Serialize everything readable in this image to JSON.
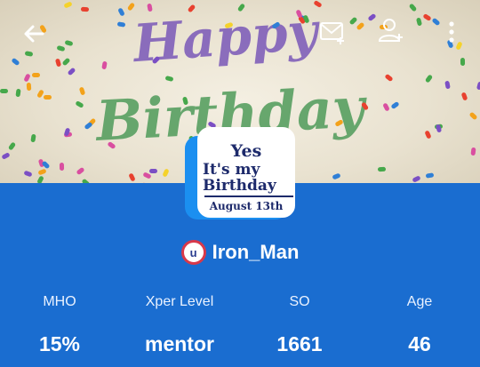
{
  "cover": {
    "image": "birthday-cake-photo",
    "decor_text": [
      "Happy",
      "Birthday"
    ]
  },
  "toolbar": {
    "back_icon": "arrow-left-icon",
    "message_icon": "mail-plus-icon",
    "follow_icon": "user-plus-icon",
    "menu_icon": "more-vertical-icon"
  },
  "avatar": {
    "line1": "Yes",
    "line2": "It's my",
    "line3": "Birthday",
    "line4": "August 13th"
  },
  "user": {
    "badge": "u",
    "name": "Iron_Man"
  },
  "stats": [
    {
      "label": "MHO",
      "value": "15%"
    },
    {
      "label": "Xper Level",
      "value": "mentor"
    },
    {
      "label": "SO",
      "value": "1661"
    },
    {
      "label": "Age",
      "value": "46"
    }
  ],
  "colors": {
    "panel": "#1a6dd0",
    "avatar_accent": "#1b8ff0",
    "badge_ring": "#d8394a"
  }
}
